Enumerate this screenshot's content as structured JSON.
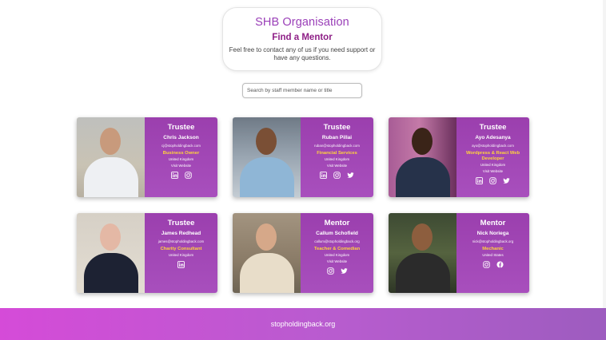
{
  "header": {
    "org_name": "SHB Organisation",
    "subtitle": "Find a Mentor",
    "description": "Feel free to contact any of us if you need support or have any questions."
  },
  "search": {
    "placeholder": "Search by staff member name or title"
  },
  "members": [
    {
      "role": "Trustee",
      "name": "Chris Jackson",
      "email": "cj@stopholdingback.com",
      "job": "Business Owner",
      "country": "United Kingdom",
      "website": "Visit Website",
      "icons": [
        "linkedin-icon",
        "instagram-icon"
      ]
    },
    {
      "role": "Trustee",
      "name": "Ruban Pillai",
      "email": "ruban@stopholdingback.com",
      "job": "Financial Services",
      "country": "United Kingdom",
      "website": "Visit Website",
      "icons": [
        "linkedin-icon",
        "instagram-icon",
        "twitter-icon"
      ]
    },
    {
      "role": "Trustee",
      "name": "Ayo Adesanya",
      "email": "ayo@stopholdingback.com",
      "job": "Wordpress & React Web Developer",
      "country": "United Kingdom",
      "website": "Visit Website",
      "icons": [
        "linkedin-icon",
        "instagram-icon",
        "twitter-icon"
      ]
    },
    {
      "role": "Trustee",
      "name": "James Redhead",
      "email": "james@stopholdingback.com",
      "job": "Charity Consultant",
      "country": "United Kingdom",
      "website": "",
      "icons": [
        "linkedin-icon"
      ]
    },
    {
      "role": "Mentor",
      "name": "Callum Schofield",
      "email": "callum@stopholdingback.org",
      "job": "Teacher & Comedian",
      "country": "United Kingdom",
      "website": "Visit Website",
      "icons": [
        "instagram-icon",
        "twitter-icon"
      ]
    },
    {
      "role": "Mentor",
      "name": "Nick Noriega",
      "email": "nick@stopholdingback.org",
      "job": "Mechanic",
      "country": "United States",
      "website": "",
      "icons": [
        "instagram-icon",
        "facebook-icon"
      ]
    }
  ],
  "footer": {
    "link": "stopholdingback.org"
  },
  "colors": {
    "accent": "#a84fbd",
    "highlight": "#ffd43b",
    "title": "#8e1f86"
  }
}
